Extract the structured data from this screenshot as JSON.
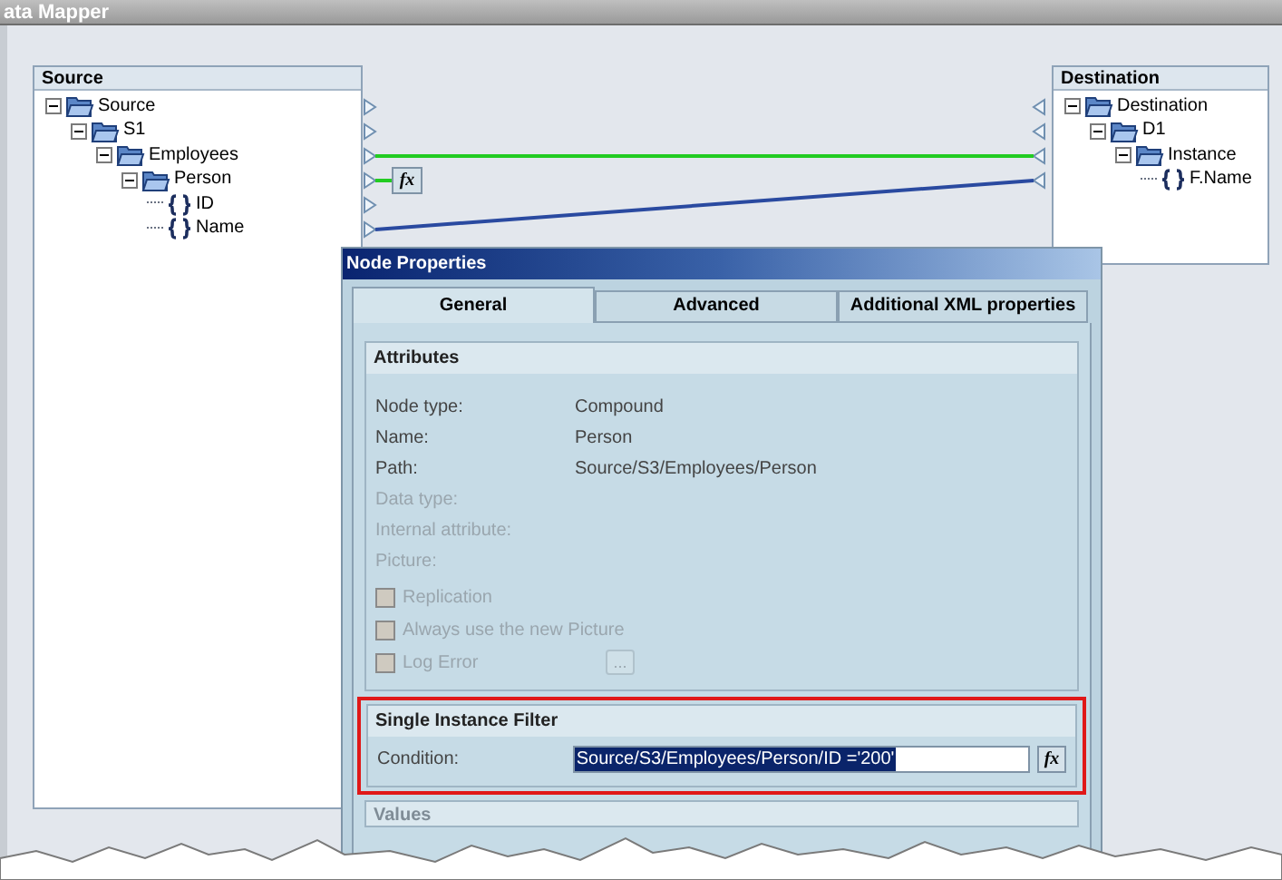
{
  "window": {
    "title": "ata Mapper"
  },
  "source": {
    "title": "Source",
    "tree": [
      {
        "label": "Source",
        "kind": "folder",
        "expanded": true,
        "children": [
          {
            "label": "S1",
            "kind": "folder",
            "expanded": true,
            "children": [
              {
                "label": "Employees",
                "kind": "folder",
                "expanded": true,
                "children": [
                  {
                    "label": "Person",
                    "kind": "folder",
                    "expanded": true,
                    "children": [
                      {
                        "label": "ID",
                        "kind": "element"
                      },
                      {
                        "label": "Name",
                        "kind": "element"
                      }
                    ]
                  }
                ]
              }
            ]
          }
        ]
      }
    ]
  },
  "mapping": {
    "function_button": "fx"
  },
  "destination": {
    "title": "Destination",
    "tree": [
      {
        "label": "Destination",
        "kind": "folder",
        "expanded": true,
        "children": [
          {
            "label": "D1",
            "kind": "folder",
            "expanded": true,
            "children": [
              {
                "label": "Instance",
                "kind": "folder",
                "expanded": true,
                "children": [
                  {
                    "label": "F.Name",
                    "kind": "element"
                  }
                ]
              }
            ]
          }
        ]
      }
    ]
  },
  "dialog": {
    "title": "Node Properties",
    "tabs": [
      {
        "label": "General",
        "selected": true
      },
      {
        "label": "Advanced",
        "selected": false
      },
      {
        "label": "Additional XML properties",
        "selected": false
      }
    ],
    "attributes": {
      "title": "Attributes",
      "rows": [
        {
          "label": "Node type:",
          "value": "Compound",
          "disabled": false
        },
        {
          "label": "Name:",
          "value": "Person",
          "disabled": false
        },
        {
          "label": "Path:",
          "value": "Source/S3/Employees/Person",
          "disabled": false
        },
        {
          "label": "Data type:",
          "disabled": true
        },
        {
          "label": "Internal attribute:",
          "disabled": true
        },
        {
          "label": "Picture:",
          "disabled": true
        }
      ],
      "checkboxes": [
        {
          "label": "Replication",
          "checked": false,
          "disabled": true
        },
        {
          "label": "Always use the new Picture",
          "checked": false,
          "disabled": true
        },
        {
          "label": "Log Error",
          "checked": false,
          "disabled": true,
          "button": "..."
        }
      ]
    },
    "filter": {
      "title": "Single Instance Filter",
      "label": "Condition:",
      "value": "Source/S3/Employees/Person/ID ='200'",
      "function_button": "fx"
    },
    "values": {
      "title": "Values"
    }
  }
}
